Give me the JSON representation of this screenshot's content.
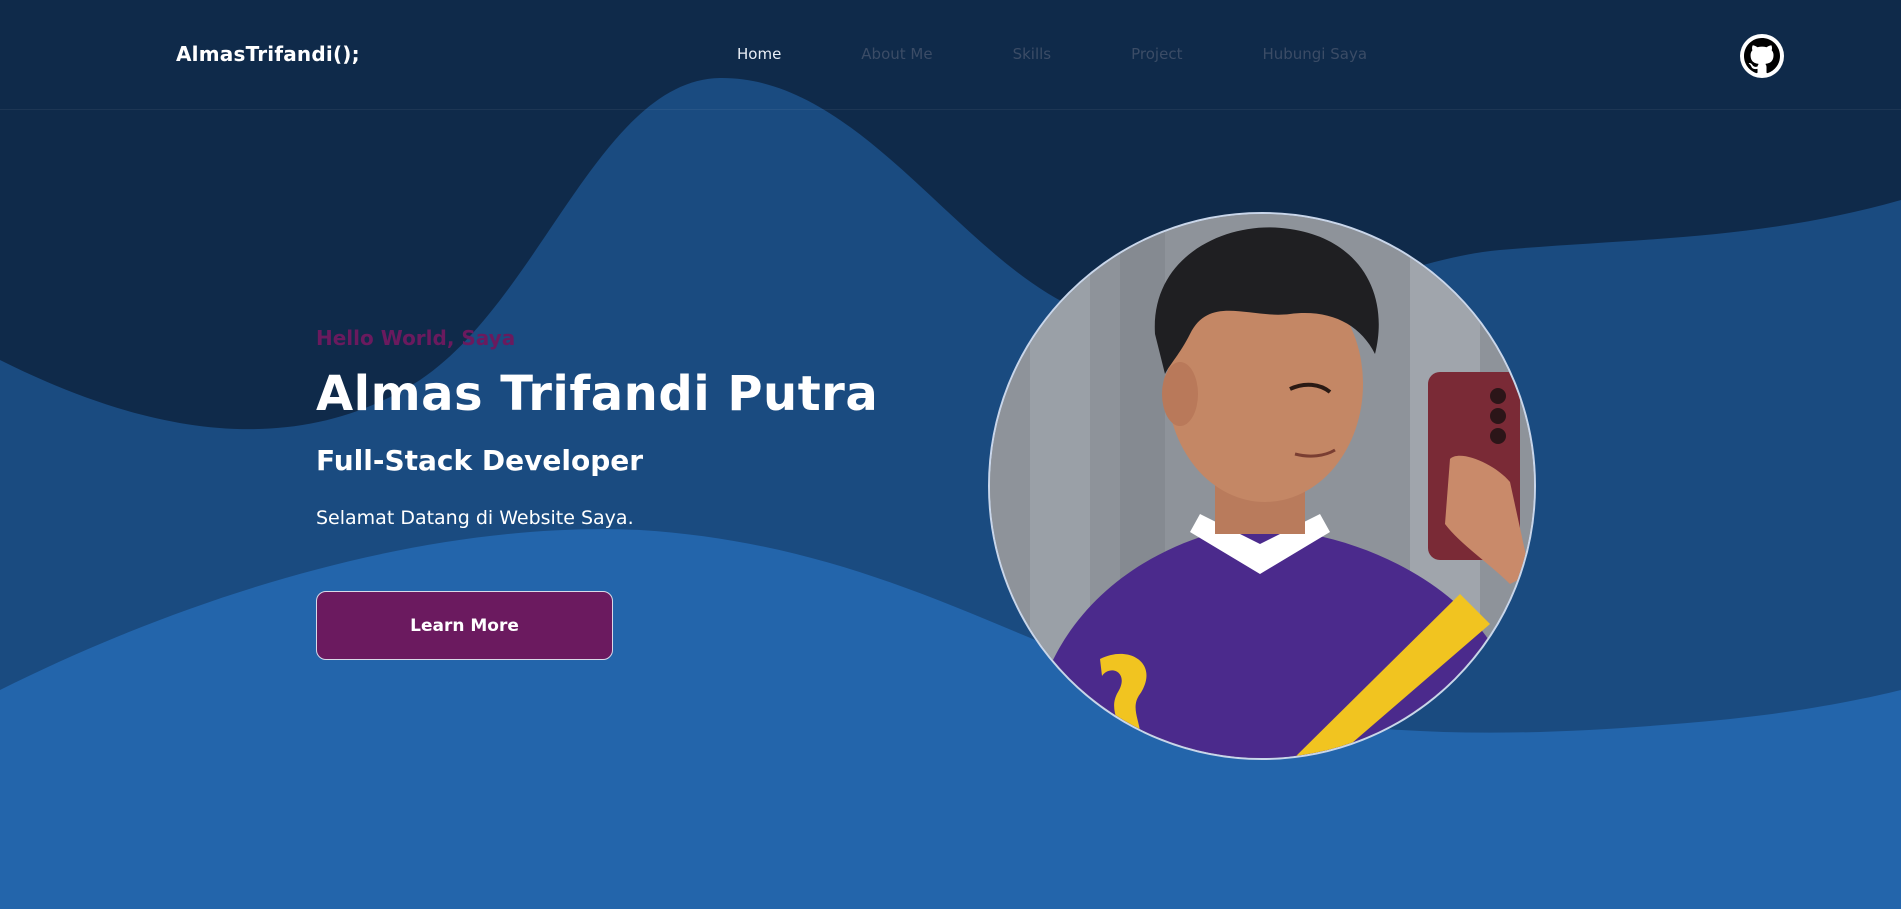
{
  "colors": {
    "bg_dark": "#0f2a4a",
    "wave_mid": "#1a4b80",
    "wave_light": "#2365ab",
    "accent": "#6b1a5f",
    "greeting": "#6a1a5e"
  },
  "navbar": {
    "brand": "AlmasTrifandi();",
    "links": [
      {
        "label": "Home",
        "active": true
      },
      {
        "label": "About Me",
        "active": false
      },
      {
        "label": "Skills",
        "active": false
      },
      {
        "label": "Project",
        "active": false
      },
      {
        "label": "Hubungi Saya",
        "active": false
      }
    ],
    "github_icon": "github-icon"
  },
  "hero": {
    "greeting": "Hello World, Saya",
    "name": "Almas Trifandi Putra",
    "role": "Full-Stack Developer",
    "welcome": "Selamat Datang di Website Saya.",
    "cta_label": "Learn More"
  }
}
